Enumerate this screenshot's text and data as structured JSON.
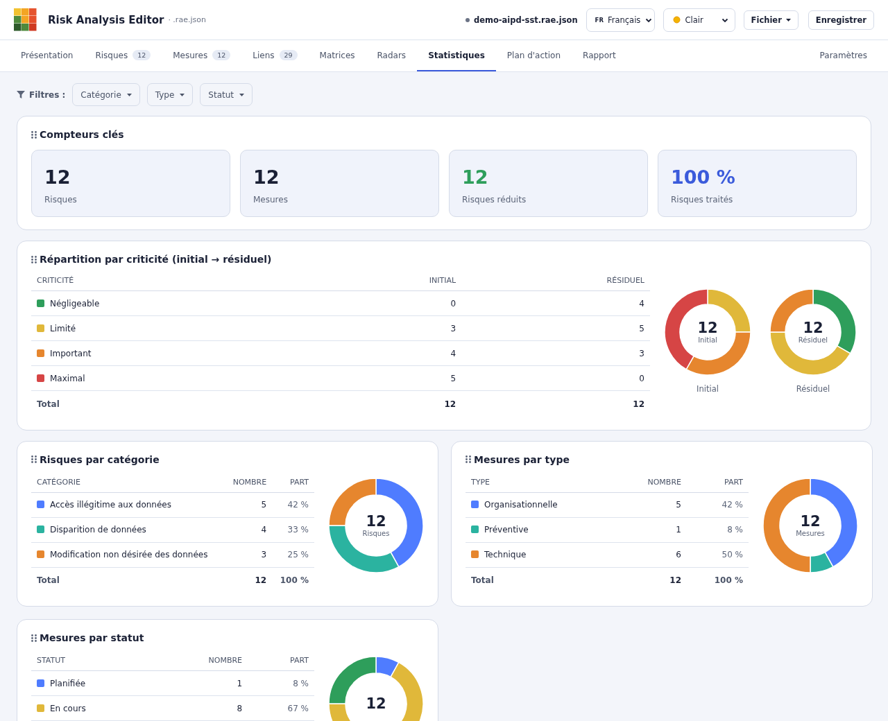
{
  "app": {
    "title": "Risk Analysis Editor",
    "subtitle": "· .rae.json",
    "file": "demo-aipd-sst.rae.json",
    "language": {
      "code": "FR",
      "label": "Français"
    },
    "theme": {
      "label": "Clair"
    },
    "buttons": [
      {
        "label": "Fichier",
        "kind": "menu"
      },
      {
        "label": "Enregistrer",
        "kind": "plain"
      }
    ]
  },
  "tabs": [
    {
      "label": "Présentation",
      "selected": false
    },
    {
      "label": "Risques",
      "badge": "12",
      "selected": false
    },
    {
      "label": "Mesures",
      "badge": "12",
      "selected": false
    },
    {
      "label": "Liens",
      "badge": "29",
      "selected": false
    },
    {
      "label": "Matrices",
      "selected": false
    },
    {
      "label": "Radars",
      "selected": false
    },
    {
      "label": "Statistiques",
      "selected": true
    },
    {
      "label": "Plan d'action",
      "selected": false
    },
    {
      "label": "Rapport",
      "selected": false
    }
  ],
  "settings_tab": {
    "label": "Paramètres",
    "selected": false
  },
  "filters": {
    "label": "Filtres :",
    "dropdowns": [
      "Catégorie",
      "Type",
      "Statut"
    ]
  },
  "counters": {
    "title": "Compteurs clés",
    "items": [
      {
        "value": "12",
        "label": "Risques",
        "color": "#1a2035"
      },
      {
        "value": "12",
        "label": "Mesures",
        "color": "#1a2035"
      },
      {
        "value": "12",
        "label": "Risques réduits",
        "color": "#2e9e5b"
      },
      {
        "value": "100 %",
        "label": "Risques traités",
        "color": "#3b5bdb"
      }
    ]
  },
  "criticality": {
    "title": "Répartition par criticité (initial → résiduel)",
    "columns": [
      "CRITICITÉ",
      "INITIAL",
      "RÉSIDUEL"
    ],
    "rows": [
      {
        "color": "#2e9e5b",
        "cells": [
          "Négligeable",
          "0",
          "4"
        ]
      },
      {
        "color": "#e0b83a",
        "cells": [
          "Limité",
          "3",
          "5"
        ]
      },
      {
        "color": "#e6862e",
        "cells": [
          "Important",
          "4",
          "3"
        ]
      },
      {
        "color": "#d64545",
        "cells": [
          "Maximal",
          "5",
          "0"
        ]
      }
    ],
    "total": [
      "Total",
      "12",
      "12"
    ],
    "charts": [
      {
        "center_value": "12",
        "center_label": "Initial",
        "caption": "Initial",
        "chart_data": {
          "type": "donut",
          "colors": [
            "#2e9e5b",
            "#e0b83a",
            "#e6862e",
            "#d64545"
          ],
          "values": [
            0,
            25,
            33.3,
            41.7
          ]
        }
      },
      {
        "center_value": "12",
        "center_label": "Résiduel",
        "caption": "Résiduel",
        "chart_data": {
          "type": "donut",
          "colors": [
            "#2e9e5b",
            "#e0b83a",
            "#e6862e",
            "#d64545"
          ],
          "values": [
            33.3,
            41.7,
            25,
            0
          ]
        }
      }
    ]
  },
  "breakdowns": [
    {
      "title": "Risques par catégorie",
      "columns": [
        "CATÉGORIE",
        "NOMBRE",
        "PART"
      ],
      "rows": [
        {
          "color": "#4f7cff",
          "cells": [
            "Accès illégitime aux données",
            "5",
            "42 %"
          ]
        },
        {
          "color": "#2bb3a0",
          "cells": [
            "Disparition de données",
            "4",
            "33 %"
          ]
        },
        {
          "color": "#e6862e",
          "cells": [
            "Modification non désirée des données",
            "3",
            "25 %"
          ]
        }
      ],
      "total": [
        "Total",
        "12",
        "100 %"
      ],
      "chart": {
        "center_value": "12",
        "center_label": "Risques",
        "chart_data": {
          "type": "donut",
          "colors": [
            "#4f7cff",
            "#2bb3a0",
            "#e6862e"
          ],
          "values": [
            42,
            33,
            25
          ]
        }
      }
    },
    {
      "title": "Mesures par type",
      "columns": [
        "TYPE",
        "NOMBRE",
        "PART"
      ],
      "rows": [
        {
          "color": "#4f7cff",
          "cells": [
            "Organisationnelle",
            "5",
            "42 %"
          ]
        },
        {
          "color": "#2bb3a0",
          "cells": [
            "Préventive",
            "1",
            "8 %"
          ]
        },
        {
          "color": "#e6862e",
          "cells": [
            "Technique",
            "6",
            "50 %"
          ]
        }
      ],
      "total": [
        "Total",
        "12",
        "100 %"
      ],
      "chart": {
        "center_value": "12",
        "center_label": "Mesures",
        "chart_data": {
          "type": "donut",
          "colors": [
            "#4f7cff",
            "#2bb3a0",
            "#e6862e"
          ],
          "values": [
            42,
            8,
            50
          ]
        }
      }
    },
    {
      "title": "Mesures par statut",
      "columns": [
        "STATUT",
        "NOMBRE",
        "PART"
      ],
      "rows": [
        {
          "color": "#4f7cff",
          "cells": [
            "Planifiée",
            "1",
            "8 %"
          ]
        },
        {
          "color": "#e0b83a",
          "cells": [
            "En cours",
            "8",
            "67 %"
          ]
        }
      ],
      "chart": {
        "center_value": "12",
        "chart_data": {
          "type": "donut",
          "colors": [
            "#4f7cff",
            "#e0b83a",
            "#2e9e5b"
          ],
          "values": [
            8,
            67,
            25
          ]
        }
      }
    }
  ]
}
